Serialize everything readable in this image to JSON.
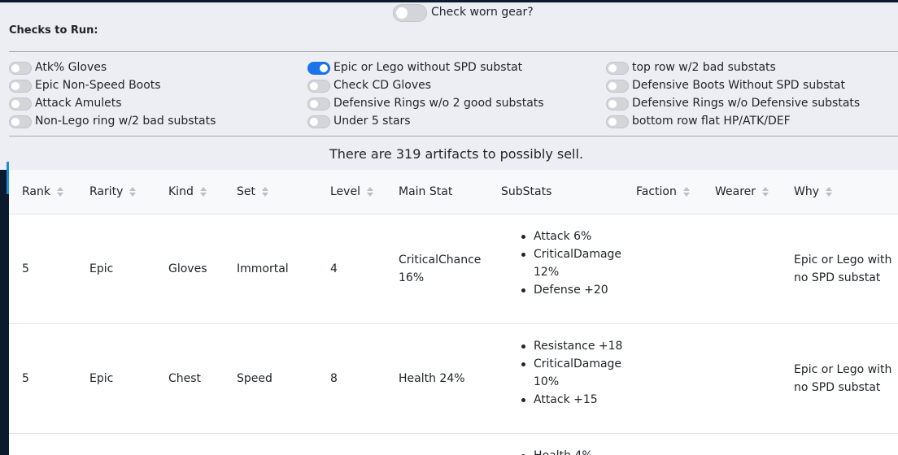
{
  "worn_gear": {
    "label": "Check worn gear?",
    "on": false
  },
  "checks_title": "Checks to Run:",
  "checks": {
    "col1": [
      {
        "label": "Atk% Gloves",
        "on": false
      },
      {
        "label": "Epic Non-Speed Boots",
        "on": false
      },
      {
        "label": "Attack Amulets",
        "on": false
      },
      {
        "label": "Non-Lego ring w/2 bad substats",
        "on": false
      }
    ],
    "col2": [
      {
        "label": "Epic or Lego without SPD substat",
        "on": true
      },
      {
        "label": "Check CD Gloves",
        "on": false
      },
      {
        "label": "Defensive Rings w/o 2 good substats",
        "on": false
      },
      {
        "label": "Under 5 stars",
        "on": false
      }
    ],
    "col3": [
      {
        "label": "top row w/2 bad substats",
        "on": false
      },
      {
        "label": "Defensive Boots Without SPD substat",
        "on": false
      },
      {
        "label": "Defensive Rings w/o Defensive substats",
        "on": false
      },
      {
        "label": "bottom row flat HP/ATK/DEF",
        "on": false
      }
    ]
  },
  "summary": "There are 319 artifacts to possibly sell.",
  "table": {
    "headers": {
      "rank": "Rank",
      "rarity": "Rarity",
      "kind": "Kind",
      "set": "Set",
      "level": "Level",
      "main_stat": "Main Stat",
      "substats": "SubStats",
      "faction": "Faction",
      "wearer": "Wearer",
      "why": "Why"
    },
    "rows": [
      {
        "rank": "5",
        "rarity": "Epic",
        "kind": "Gloves",
        "set": "Immortal",
        "level": "4",
        "main_stat_1": "CriticalChance",
        "main_stat_2": "16%",
        "substats": [
          "Attack 6%",
          "CriticalDamage",
          "12%",
          "Defense +20"
        ],
        "faction": "",
        "wearer": "",
        "why_1": "Epic or Lego with",
        "why_2": "no SPD substat"
      },
      {
        "rank": "5",
        "rarity": "Epic",
        "kind": "Chest",
        "set": "Speed",
        "level": "8",
        "main_stat_1": "Health 24%",
        "main_stat_2": "",
        "substats": [
          "Resistance +18",
          "CriticalDamage",
          "10%",
          "Attack +15"
        ],
        "faction": "",
        "wearer": "",
        "why_1": "Epic or Lego with",
        "why_2": "no SPD substat"
      },
      {
        "substats_partial": "Health 4%"
      }
    ]
  },
  "colors": {
    "toggle_on": "#1a73e8",
    "page_bg": "#0b1a2c",
    "panel_bg": "#eceef4"
  }
}
